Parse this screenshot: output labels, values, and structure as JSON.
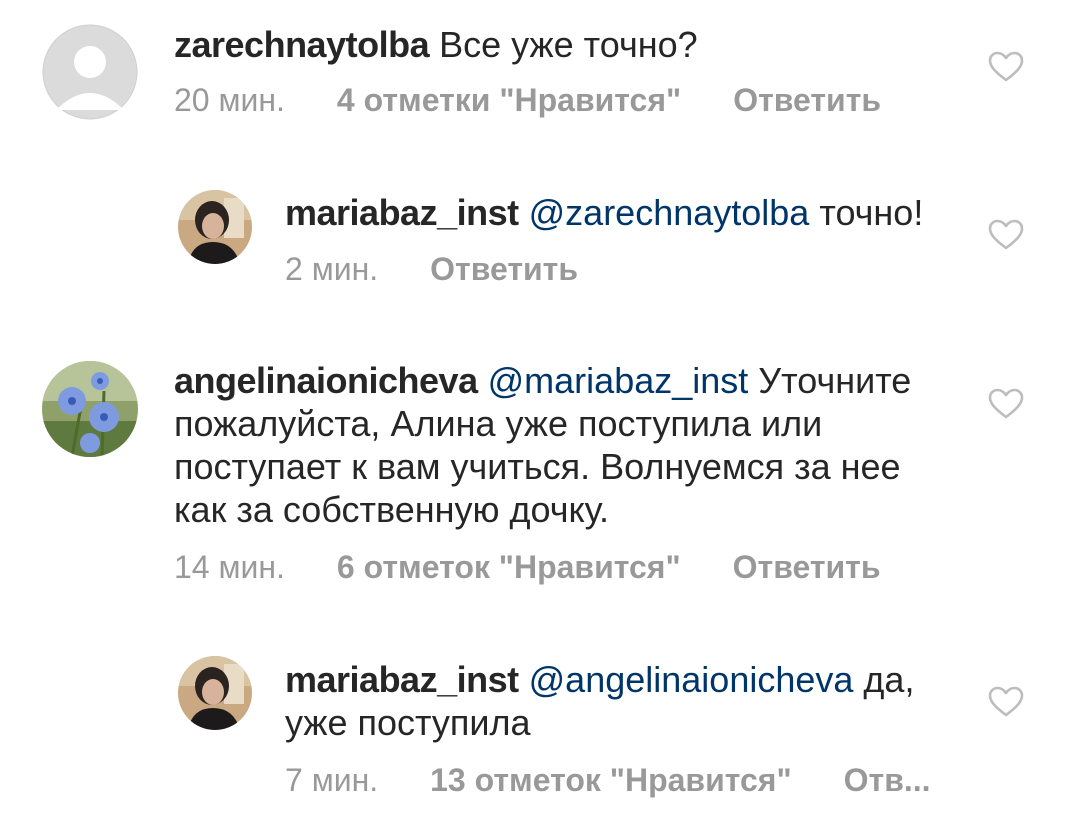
{
  "comments": [
    {
      "username": "zarechnaytolba",
      "mention": "",
      "text": "Все уже точно?",
      "time": "20 мин.",
      "likes": "4 отметки \"Нравится\"",
      "reply": "Ответить",
      "avatar": "default-avatar",
      "heart_icon": "heart-outline-icon"
    },
    {
      "username": "mariabaz_inst",
      "mention": "@zarechnaytolba",
      "text": "точно!",
      "time": "2 мин.",
      "likes": "",
      "reply": "Ответить",
      "avatar": "profile-photo",
      "heart_icon": "heart-outline-icon"
    },
    {
      "username": "angelinaionicheva",
      "mention": "@mariabaz_inst",
      "text": "Уточните пожалуйста, Алина уже поступила  или поступает к  вам  учиться.  Волнуемся за нее как  за собственную дочку.",
      "time": "14 мин.",
      "likes": "6 отметок \"Нравится\"",
      "reply": "Ответить",
      "avatar": "flower-photo",
      "heart_icon": "heart-outline-icon"
    },
    {
      "username": "mariabaz_inst",
      "mention": "@angelinaionicheva",
      "text": "да, уже поступила",
      "time": "7 мин.",
      "likes": "13 отметок \"Нравится\"",
      "reply": "Отв...",
      "avatar": "profile-photo",
      "heart_icon": "heart-outline-icon"
    }
  ],
  "colors": {
    "text": "#262626",
    "meta": "#999999",
    "mention": "#003569",
    "heart": "#bdbdbd"
  }
}
